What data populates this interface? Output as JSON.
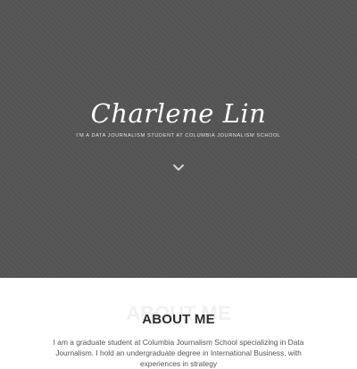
{
  "hero": {
    "name": "Charlene Lin",
    "tagline": "I'M A DATA JOURNALISM STUDENT AT COLUMBIA JOURNALISM SCHOOL",
    "scroll_icon": "chevron-down-icon",
    "background_color": "#545454"
  },
  "about": {
    "ghost_text": "ABOUT ME",
    "heading": "ABOUT ME",
    "paragraph": "I am a graduate student at Columbia Journalism School specializing in Data Journalism. I hold an undergraduate degree in International Business, with experiences in strategy"
  }
}
